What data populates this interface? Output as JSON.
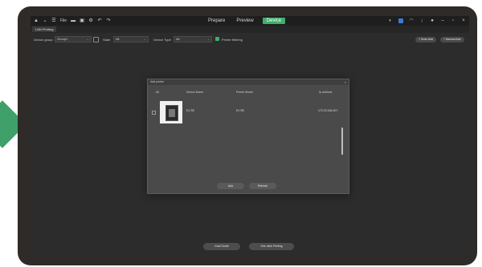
{
  "titlebar": {
    "menu_label": "File",
    "tabs": [
      {
        "label": "Prepare"
      },
      {
        "label": "Preview"
      },
      {
        "label": "Device"
      }
    ],
    "active_tab": "Device"
  },
  "subbar": {
    "tab_label": "LAN Printing"
  },
  "filters": {
    "device_group_label": "Device group",
    "device_group_value": "Group1",
    "state_label": "State",
    "state_value": "All",
    "device_type_label": "Device Type",
    "device_type_value": "All",
    "printer_checkbox_label": "Printer filtering",
    "scan_button": "+ Scan Add",
    "manual_button": "+ Manual Add"
  },
  "dialog": {
    "title": "Add printer",
    "columns": {
      "all": "All",
      "device_name": "Device Name",
      "printer_model": "Printer Model",
      "ip_address": "Ip address"
    },
    "rows": [
      {
        "device_name": "K1 SE",
        "printer_model": "K1 SE",
        "ip_address": "172.23.184.107"
      }
    ],
    "add_button": "Add",
    "refresh_button": "Refresh"
  },
  "bottom": {
    "guide_button": "Guid Guide",
    "one_click_button": "One click Printing"
  },
  "colors": {
    "accent": "#3fae6b",
    "frame": "#2e2b29",
    "arrow": "#3fa06a"
  }
}
